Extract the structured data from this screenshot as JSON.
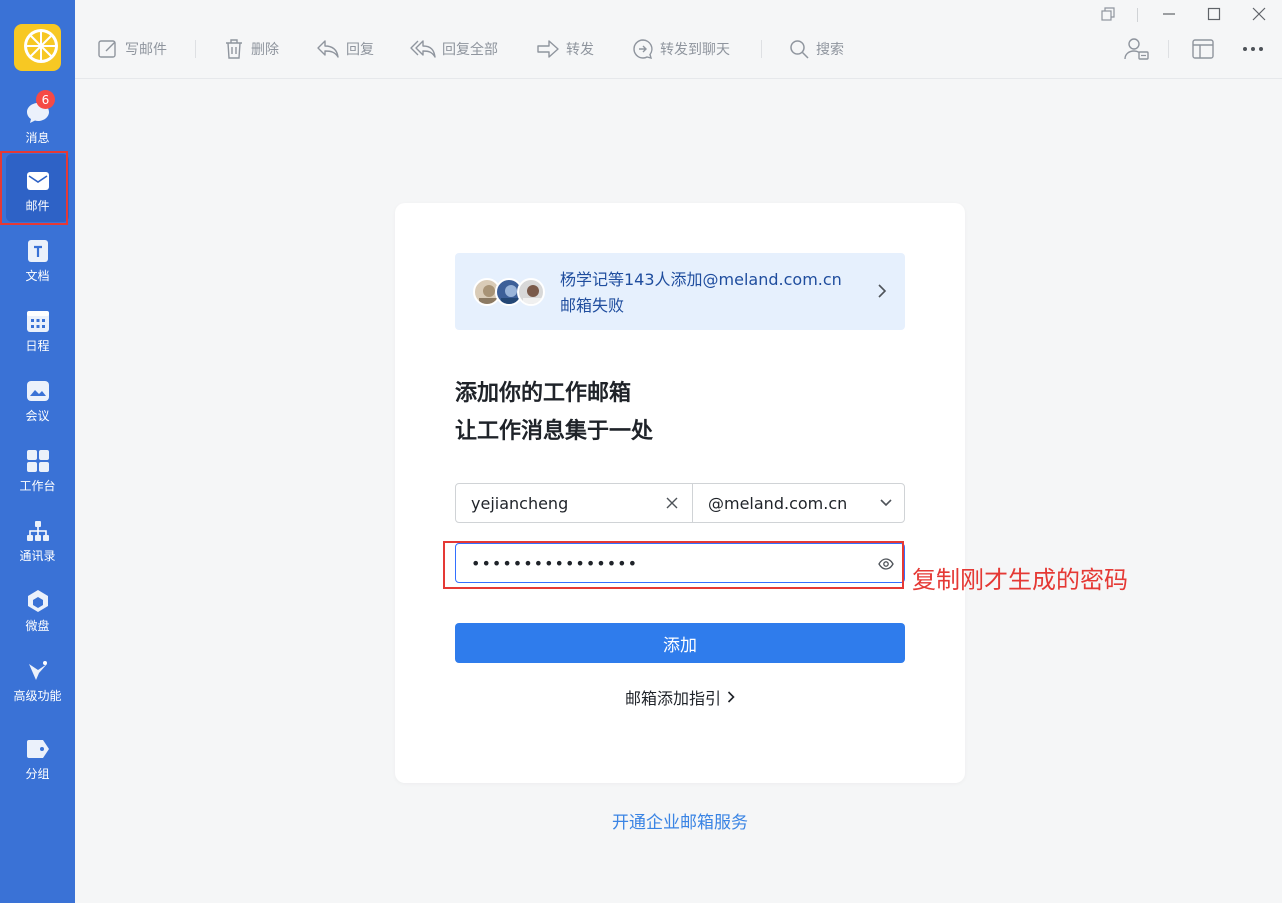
{
  "sidebar": {
    "badge_count": "6",
    "items": [
      {
        "label": "消息",
        "icon": "chat-bubble-icon"
      },
      {
        "label": "邮件",
        "icon": "envelope-icon"
      },
      {
        "label": "文档",
        "icon": "document-icon"
      },
      {
        "label": "日程",
        "icon": "calendar-icon"
      },
      {
        "label": "会议",
        "icon": "meeting-icon"
      },
      {
        "label": "工作台",
        "icon": "grid-icon"
      },
      {
        "label": "通讯录",
        "icon": "org-chart-icon"
      },
      {
        "label": "微盘",
        "icon": "cloud-drive-icon"
      },
      {
        "label": "高级功能",
        "icon": "sparkle-icon"
      },
      {
        "label": "分组",
        "icon": "tag-icon"
      }
    ],
    "active": "邮件"
  },
  "toolbar": {
    "compose": "写邮件",
    "delete": "删除",
    "reply": "回复",
    "reply_all": "回复全部",
    "forward": "转发",
    "forward_chat": "转发到聊天",
    "search": "搜索"
  },
  "card": {
    "notice_line1": "杨学记等143人添加@meland.com.cn",
    "notice_line2": "邮箱失败",
    "headline_line1": "添加你的工作邮箱",
    "headline_line2": "让工作消息集于一处",
    "username_value": "yejiancheng",
    "domain_value": "@meland.com.cn",
    "password_value": "••••••••••••••••",
    "add_button": "添加",
    "guide_link": "邮箱添加指引"
  },
  "annotation_text": "复制刚才生成的密码",
  "bottom_link": "开通企业邮箱服务",
  "colors": {
    "sidebar": "#3a72d6",
    "primary": "#2f7cec",
    "annotation": "#e53935"
  }
}
